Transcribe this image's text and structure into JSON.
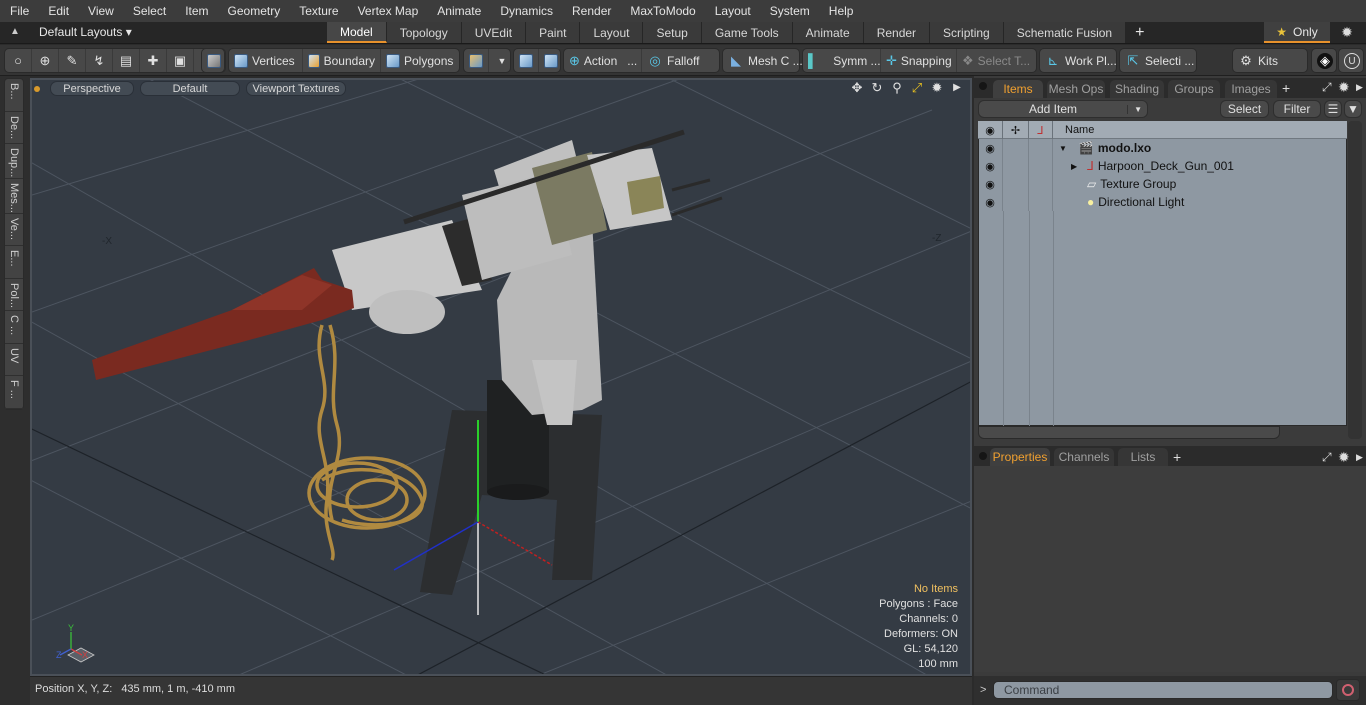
{
  "menu": [
    "File",
    "Edit",
    "View",
    "Select",
    "Item",
    "Geometry",
    "Texture",
    "Vertex Map",
    "Animate",
    "Dynamics",
    "Render",
    "MaxToModo",
    "Layout",
    "System",
    "Help"
  ],
  "layout_selector": "Default Layouts ▾",
  "mode_tabs": [
    "Model",
    "Topology",
    "UVEdit",
    "Paint",
    "Layout",
    "Setup",
    "Game Tools",
    "Animate",
    "Render",
    "Scripting",
    "Schematic Fusion"
  ],
  "active_mode_tab": "Model",
  "only_button": "Only",
  "toolbar": {
    "vertices": "Vertices",
    "boundary": "Boundary",
    "polygons": "Polygons",
    "action": "Action",
    "action_more": "...",
    "falloff": "Falloff",
    "mesh_c": "Mesh C ...",
    "symm": "Symm ...",
    "snapping": "Snapping",
    "select_t": "Select T...",
    "work_pl": "Work Pl...",
    "selecti": "Selecti ...",
    "kits": "Kits"
  },
  "left_tabs": [
    "B...",
    "De...",
    "Dup...",
    "Mes...",
    "Ve...",
    "E...",
    "Pol...",
    "C ...",
    "UV",
    "F ..."
  ],
  "viewport": {
    "view": "Perspective",
    "style": "Default",
    "shading": "Viewport Textures",
    "axis_labels": {
      "neg_x": "-X",
      "neg_z": "-Z"
    },
    "gizmo": {
      "x": "X",
      "y": "Y",
      "z": "Z"
    },
    "info": {
      "selection": "No Items",
      "polygons": "Polygons : Face",
      "channels": "Channels: 0",
      "deformers": "Deformers: ON",
      "gl": "GL: 54,120",
      "grid": "100 mm"
    }
  },
  "status": {
    "position_label": "Position X, Y, Z:",
    "position_value": "435 mm, 1 m, -410 mm"
  },
  "items_panel": {
    "tabs": [
      "Items",
      "Mesh Ops",
      "Shading",
      "Groups",
      "Images"
    ],
    "active_tab": "Items",
    "add_item": "Add Item",
    "select": "Select",
    "filter": "Filter",
    "column_name": "Name",
    "tree": [
      {
        "name": "modo.lxo",
        "icon": "scene-icon",
        "level": 0,
        "expanded": true,
        "bold": true
      },
      {
        "name": "Harpoon_Deck_Gun_001",
        "icon": "locator-icon",
        "level": 1,
        "expanded": false
      },
      {
        "name": "Texture Group",
        "icon": "folder-icon",
        "level": 1
      },
      {
        "name": "Directional Light",
        "icon": "light-icon",
        "level": 1
      }
    ]
  },
  "props_panel": {
    "tabs": [
      "Properties",
      "Channels",
      "Lists"
    ],
    "active_tab": "Properties"
  },
  "command": {
    "prompt": ">",
    "placeholder": "Command"
  }
}
